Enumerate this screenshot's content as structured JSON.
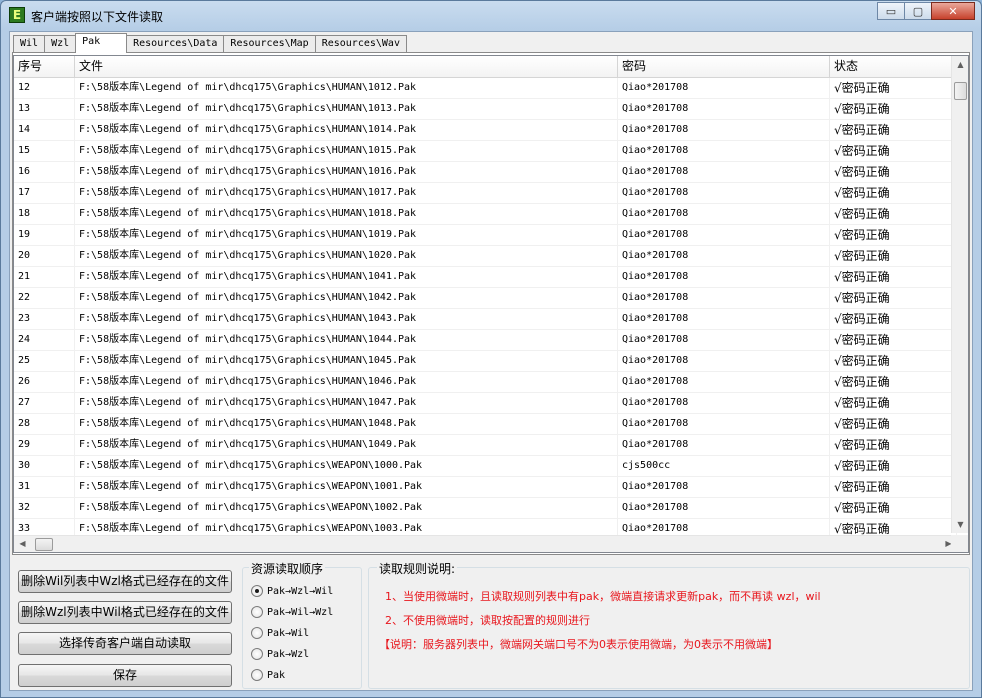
{
  "window": {
    "title": "客户端按照以下文件读取",
    "icon_letter": "E",
    "minimize_glyph": "▭",
    "maximize_glyph": "▢",
    "close_glyph": "✕"
  },
  "tabs": [
    {
      "label": "Wil",
      "active": false
    },
    {
      "label": "Wzl",
      "active": false
    },
    {
      "label": "Pak",
      "active": true
    },
    {
      "label": "Resources\\Data",
      "active": false
    },
    {
      "label": "Resources\\Map",
      "active": false
    },
    {
      "label": "Resources\\Wav",
      "active": false
    }
  ],
  "table": {
    "columns": [
      "序号",
      "文件",
      "密码",
      "状态"
    ],
    "rows": [
      [
        "12",
        "F:\\58版本库\\Legend of mir\\dhcq175\\Graphics\\HUMAN\\1012.Pak",
        "Qiao*201708",
        "√密码正确"
      ],
      [
        "13",
        "F:\\58版本库\\Legend of mir\\dhcq175\\Graphics\\HUMAN\\1013.Pak",
        "Qiao*201708",
        "√密码正确"
      ],
      [
        "14",
        "F:\\58版本库\\Legend of mir\\dhcq175\\Graphics\\HUMAN\\1014.Pak",
        "Qiao*201708",
        "√密码正确"
      ],
      [
        "15",
        "F:\\58版本库\\Legend of mir\\dhcq175\\Graphics\\HUMAN\\1015.Pak",
        "Qiao*201708",
        "√密码正确"
      ],
      [
        "16",
        "F:\\58版本库\\Legend of mir\\dhcq175\\Graphics\\HUMAN\\1016.Pak",
        "Qiao*201708",
        "√密码正确"
      ],
      [
        "17",
        "F:\\58版本库\\Legend of mir\\dhcq175\\Graphics\\HUMAN\\1017.Pak",
        "Qiao*201708",
        "√密码正确"
      ],
      [
        "18",
        "F:\\58版本库\\Legend of mir\\dhcq175\\Graphics\\HUMAN\\1018.Pak",
        "Qiao*201708",
        "√密码正确"
      ],
      [
        "19",
        "F:\\58版本库\\Legend of mir\\dhcq175\\Graphics\\HUMAN\\1019.Pak",
        "Qiao*201708",
        "√密码正确"
      ],
      [
        "20",
        "F:\\58版本库\\Legend of mir\\dhcq175\\Graphics\\HUMAN\\1020.Pak",
        "Qiao*201708",
        "√密码正确"
      ],
      [
        "21",
        "F:\\58版本库\\Legend of mir\\dhcq175\\Graphics\\HUMAN\\1041.Pak",
        "Qiao*201708",
        "√密码正确"
      ],
      [
        "22",
        "F:\\58版本库\\Legend of mir\\dhcq175\\Graphics\\HUMAN\\1042.Pak",
        "Qiao*201708",
        "√密码正确"
      ],
      [
        "23",
        "F:\\58版本库\\Legend of mir\\dhcq175\\Graphics\\HUMAN\\1043.Pak",
        "Qiao*201708",
        "√密码正确"
      ],
      [
        "24",
        "F:\\58版本库\\Legend of mir\\dhcq175\\Graphics\\HUMAN\\1044.Pak",
        "Qiao*201708",
        "√密码正确"
      ],
      [
        "25",
        "F:\\58版本库\\Legend of mir\\dhcq175\\Graphics\\HUMAN\\1045.Pak",
        "Qiao*201708",
        "√密码正确"
      ],
      [
        "26",
        "F:\\58版本库\\Legend of mir\\dhcq175\\Graphics\\HUMAN\\1046.Pak",
        "Qiao*201708",
        "√密码正确"
      ],
      [
        "27",
        "F:\\58版本库\\Legend of mir\\dhcq175\\Graphics\\HUMAN\\1047.Pak",
        "Qiao*201708",
        "√密码正确"
      ],
      [
        "28",
        "F:\\58版本库\\Legend of mir\\dhcq175\\Graphics\\HUMAN\\1048.Pak",
        "Qiao*201708",
        "√密码正确"
      ],
      [
        "29",
        "F:\\58版本库\\Legend of mir\\dhcq175\\Graphics\\HUMAN\\1049.Pak",
        "Qiao*201708",
        "√密码正确"
      ],
      [
        "30",
        "F:\\58版本库\\Legend of mir\\dhcq175\\Graphics\\WEAPON\\1000.Pak",
        "cjs500cc",
        "√密码正确"
      ],
      [
        "31",
        "F:\\58版本库\\Legend of mir\\dhcq175\\Graphics\\WEAPON\\1001.Pak",
        "Qiao*201708",
        "√密码正确"
      ],
      [
        "32",
        "F:\\58版本库\\Legend of mir\\dhcq175\\Graphics\\WEAPON\\1002.Pak",
        "Qiao*201708",
        "√密码正确"
      ],
      [
        "33",
        "F:\\58版本库\\Legend of mir\\dhcq175\\Graphics\\WEAPON\\1003.Pak",
        "Qiao*201708",
        "√密码正确"
      ]
    ]
  },
  "scroll": {
    "up": "▲",
    "down": "▼",
    "left": "◀",
    "right": "▶"
  },
  "buttons": {
    "delete_wil": "删除Wil列表中Wzl格式已经存在的文件",
    "delete_wzl": "删除Wzl列表中Wil格式已经存在的文件",
    "select_client": "选择传奇客户端自动读取",
    "save": "保存"
  },
  "order_group": {
    "title": "资源读取顺序",
    "options": [
      {
        "label": "Pak→Wzl→Wil",
        "checked": true
      },
      {
        "label": "Pak→Wil→Wzl",
        "checked": false
      },
      {
        "label": "Pak→Wil",
        "checked": false
      },
      {
        "label": "Pak→Wzl",
        "checked": false
      },
      {
        "label": "Pak",
        "checked": false
      }
    ]
  },
  "rules_group": {
    "title": "读取规则说明:",
    "lines": [
      "1、当使用微端时，且读取规则列表中有pak，微端直接请求更新pak，而不再读 wzl，wil",
      "2、不使用微端时，读取按配置的规则进行",
      "【说明：服务器列表中，微端网关端口号不为0表示使用微端，为0表示不用微端】"
    ],
    "color": "#e8161d"
  }
}
